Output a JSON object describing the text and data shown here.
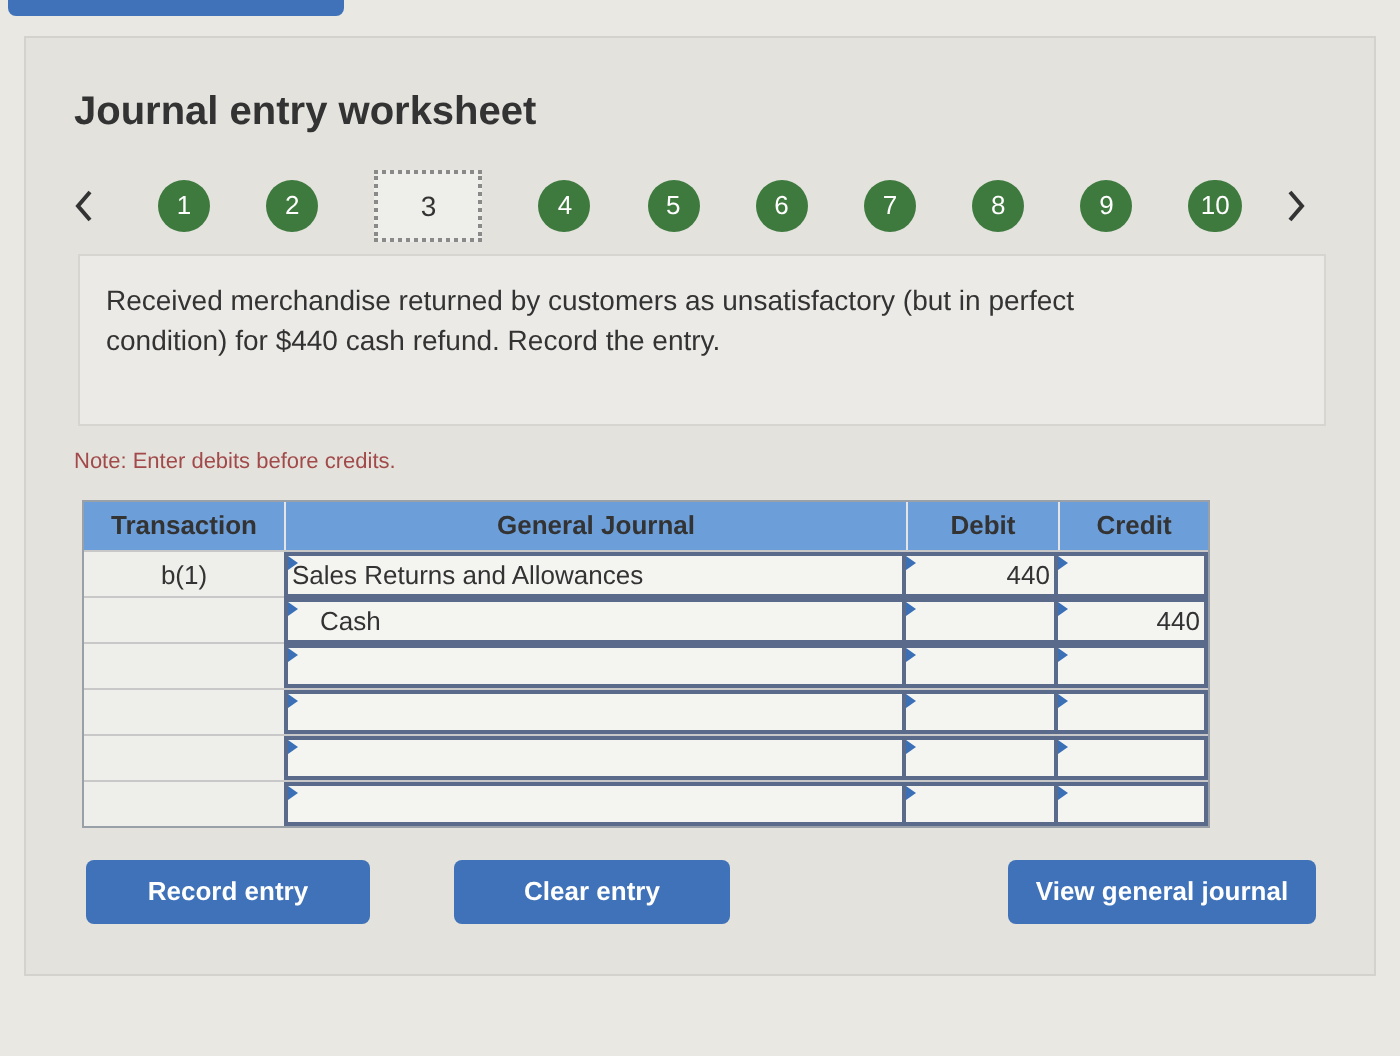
{
  "title": "Journal entry worksheet",
  "steps": [
    {
      "label": "1",
      "selected": false
    },
    {
      "label": "2",
      "selected": false
    },
    {
      "label": "3",
      "selected": true
    },
    {
      "label": "4",
      "selected": false
    },
    {
      "label": "5",
      "selected": false
    },
    {
      "label": "6",
      "selected": false
    },
    {
      "label": "7",
      "selected": false
    },
    {
      "label": "8",
      "selected": false
    },
    {
      "label": "9",
      "selected": false
    },
    {
      "label": "10",
      "selected": false
    }
  ],
  "description": "Received merchandise returned by customers as unsatisfactory (but in perfect condition) for $440 cash refund. Record the entry.",
  "note": "Note: Enter debits before credits.",
  "table": {
    "columns": [
      "Transaction",
      "General Journal",
      "Debit",
      "Credit"
    ],
    "rows": [
      {
        "transaction": "b(1)",
        "account": "Sales Returns and Allowances",
        "indented": false,
        "debit": "440"
      },
      {
        "account": "Cash",
        "indented": true,
        "credit": "440"
      },
      {},
      {},
      {},
      {}
    ]
  },
  "buttons": [
    "Record entry",
    "Clear entry",
    "View general journal"
  ]
}
